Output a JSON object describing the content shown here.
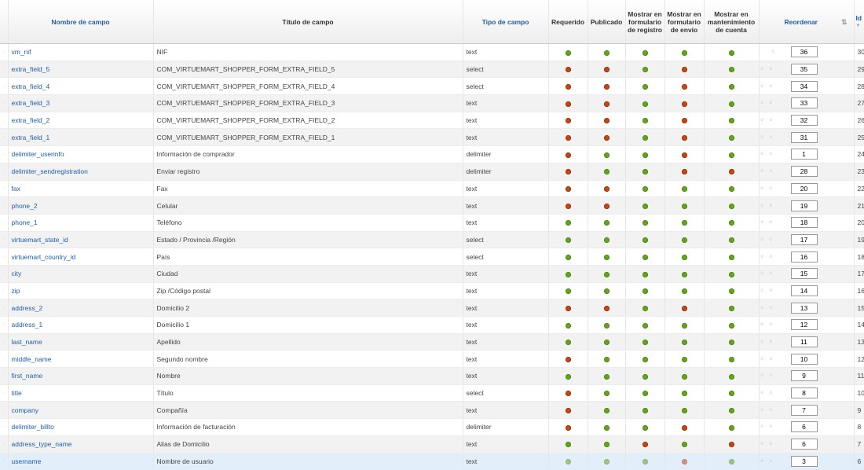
{
  "header": {
    "field_name": "Nombre de campo",
    "field_title": "Título de campo",
    "field_type": "Tipo de campo",
    "required": "Requerido",
    "published": "Publicado",
    "show_registration": "Mostrar en formulario de registro",
    "show_shipping": "Mostrar en formulario de envío",
    "show_account": "Mostrar en mantenimiento de cuenta",
    "reorder": "Reordenar",
    "id": "Id"
  },
  "icons": {
    "save_order": "save-order-icon",
    "sort": "sort-arrow-icon",
    "on": "green-check-dot",
    "off": "red-x-dot"
  },
  "colors": {
    "on": "#66a51b",
    "off": "#c44a14",
    "link": "#1f5fa8"
  },
  "rows": [
    {
      "name": "vm_nif",
      "title": "NIF",
      "type": "text",
      "req": true,
      "pub": true,
      "reg": true,
      "ship": true,
      "acct": true,
      "order": "36",
      "id": "30"
    },
    {
      "name": "extra_field_5",
      "title": "COM_VIRTUEMART_SHOPPER_FORM_EXTRA_FIELD_5",
      "type": "select",
      "req": false,
      "pub": false,
      "reg": true,
      "ship": false,
      "acct": true,
      "order": "35",
      "id": "29"
    },
    {
      "name": "extra_field_4",
      "title": "COM_VIRTUEMART_SHOPPER_FORM_EXTRA_FIELD_4",
      "type": "select",
      "req": false,
      "pub": false,
      "reg": true,
      "ship": false,
      "acct": true,
      "order": "34",
      "id": "28"
    },
    {
      "name": "extra_field_3",
      "title": "COM_VIRTUEMART_SHOPPER_FORM_EXTRA_FIELD_3",
      "type": "text",
      "req": false,
      "pub": false,
      "reg": true,
      "ship": false,
      "acct": true,
      "order": "33",
      "id": "27"
    },
    {
      "name": "extra_field_2",
      "title": "COM_VIRTUEMART_SHOPPER_FORM_EXTRA_FIELD_2",
      "type": "text",
      "req": false,
      "pub": false,
      "reg": true,
      "ship": false,
      "acct": true,
      "order": "32",
      "id": "26"
    },
    {
      "name": "extra_field_1",
      "title": "COM_VIRTUEMART_SHOPPER_FORM_EXTRA_FIELD_1",
      "type": "text",
      "req": false,
      "pub": false,
      "reg": true,
      "ship": false,
      "acct": true,
      "order": "31",
      "id": "25"
    },
    {
      "name": "delimiter_userinfo",
      "title": "Información de comprador",
      "type": "delimiter",
      "req": false,
      "pub": true,
      "reg": true,
      "ship": false,
      "acct": true,
      "order": "1",
      "id": "24"
    },
    {
      "name": "delimiter_sendregistration",
      "title": "Enviar registro",
      "type": "delimiter",
      "req": false,
      "pub": true,
      "reg": true,
      "ship": false,
      "acct": false,
      "order": "28",
      "id": "23"
    },
    {
      "name": "fax",
      "title": "Fax",
      "type": "text",
      "req": false,
      "pub": false,
      "reg": true,
      "ship": true,
      "acct": true,
      "order": "20",
      "id": "22"
    },
    {
      "name": "phone_2",
      "title": "Celular",
      "type": "text",
      "req": false,
      "pub": false,
      "reg": true,
      "ship": true,
      "acct": true,
      "order": "19",
      "id": "21"
    },
    {
      "name": "phone_1",
      "title": "Teléfono",
      "type": "text",
      "req": true,
      "pub": true,
      "reg": true,
      "ship": true,
      "acct": true,
      "order": "18",
      "id": "20"
    },
    {
      "name": "virtuemart_state_id",
      "title": "Estado / Provincia /Región",
      "type": "select",
      "req": true,
      "pub": true,
      "reg": true,
      "ship": true,
      "acct": true,
      "order": "17",
      "id": "19"
    },
    {
      "name": "virtuemart_country_id",
      "title": "País",
      "type": "select",
      "req": true,
      "pub": true,
      "reg": true,
      "ship": true,
      "acct": true,
      "order": "16",
      "id": "18"
    },
    {
      "name": "city",
      "title": "Ciudad",
      "type": "text",
      "req": true,
      "pub": true,
      "reg": true,
      "ship": true,
      "acct": true,
      "order": "15",
      "id": "17"
    },
    {
      "name": "zip",
      "title": "Zip /Código postal",
      "type": "text",
      "req": true,
      "pub": true,
      "reg": true,
      "ship": true,
      "acct": true,
      "order": "14",
      "id": "16"
    },
    {
      "name": "address_2",
      "title": "Domicilio 2",
      "type": "text",
      "req": false,
      "pub": false,
      "reg": true,
      "ship": false,
      "acct": true,
      "order": "13",
      "id": "15"
    },
    {
      "name": "address_1",
      "title": "Domicilio 1",
      "type": "text",
      "req": true,
      "pub": true,
      "reg": true,
      "ship": true,
      "acct": true,
      "order": "12",
      "id": "14"
    },
    {
      "name": "last_name",
      "title": "Apellido",
      "type": "text",
      "req": true,
      "pub": true,
      "reg": true,
      "ship": true,
      "acct": true,
      "order": "11",
      "id": "13"
    },
    {
      "name": "middle_name",
      "title": "Segundo nombre",
      "type": "text",
      "req": false,
      "pub": true,
      "reg": true,
      "ship": true,
      "acct": true,
      "order": "10",
      "id": "12"
    },
    {
      "name": "first_name",
      "title": "Nombre",
      "type": "text",
      "req": true,
      "pub": true,
      "reg": true,
      "ship": true,
      "acct": true,
      "order": "9",
      "id": "11"
    },
    {
      "name": "title",
      "title": "Título",
      "type": "select",
      "req": false,
      "pub": true,
      "reg": true,
      "ship": true,
      "acct": true,
      "order": "8",
      "id": "10"
    },
    {
      "name": "company",
      "title": "Compañía",
      "type": "text",
      "req": false,
      "pub": true,
      "reg": true,
      "ship": true,
      "acct": true,
      "order": "7",
      "id": "9"
    },
    {
      "name": "delimiter_billto",
      "title": "Información de facturación",
      "type": "delimiter",
      "req": false,
      "pub": true,
      "reg": true,
      "ship": false,
      "acct": true,
      "order": "6",
      "id": "8"
    },
    {
      "name": "address_type_name",
      "title": "Alias de Domicilio",
      "type": "text",
      "req": true,
      "pub": true,
      "reg": false,
      "ship": true,
      "acct": false,
      "order": "6",
      "id": "7"
    },
    {
      "name": "username",
      "title": "Nombre de usuario",
      "type": "text",
      "req": true,
      "pub": true,
      "reg": true,
      "ship": false,
      "acct": true,
      "order": "3",
      "id": "6"
    }
  ]
}
